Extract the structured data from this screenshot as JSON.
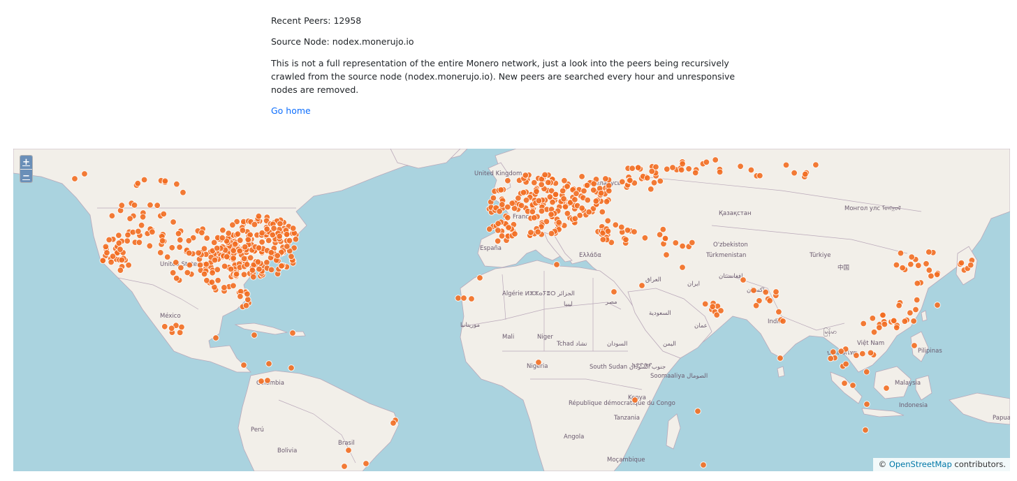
{
  "info": {
    "recent_peers": "Recent Peers: 12958",
    "source_node": "Source Node: nodex.monerujo.io",
    "description": "This is not a full representation of the entire Monero network, just a look into the peers being recursively crawled from the source node (nodex.monerujo.io). New peers are searched every hour and unresponsive nodes are removed.",
    "home_link": "Go home"
  },
  "map": {
    "zoom_in": "+",
    "zoom_out": "−",
    "attribution_prefix": "©",
    "attribution_link": "OpenStreetMap",
    "attribution_suffix": " contributors.",
    "marker_color": "#f26d21",
    "water_color": "#aad3df",
    "land_color": "#f2efe9",
    "labels": [
      "United Kingdom",
      "Беларусь",
      "Қазақстан",
      "Монгол улс ᠮᠣᠩᠭᠣᠯ",
      "O'zbekiston",
      "Türkmenistan",
      "Türkiye",
      "Ελλάδα",
      "France",
      "España",
      "United States",
      "México",
      "Algérie ⵍⵣⵣⴰⵢⴻⵔ الجزائر",
      "ليبيا",
      "مصر",
      "Mali",
      "Niger",
      "Tchad تشاد",
      "السودان",
      "السعودية",
      "اليمن",
      "عمان",
      "العراق",
      "ایران",
      "افغانستان",
      "پاکستان",
      "India",
      "中国",
      "မြန်မာ",
      "Việt Nam",
      "ประเทศไทย",
      "Pilipinas",
      "Malaysia",
      "Indonesia",
      "Papua Nu",
      "موريتانيا",
      "Nigeria",
      "South Sudan جنوب السودان",
      "ኢትዮጵያ",
      "Soomaaliya الصومال",
      "Kenya",
      "République démocratique du Congo",
      "Tanzania",
      "Angola",
      "Moçambique",
      "Colombia",
      "Perú",
      "Bolivia",
      "Brasil"
    ]
  }
}
